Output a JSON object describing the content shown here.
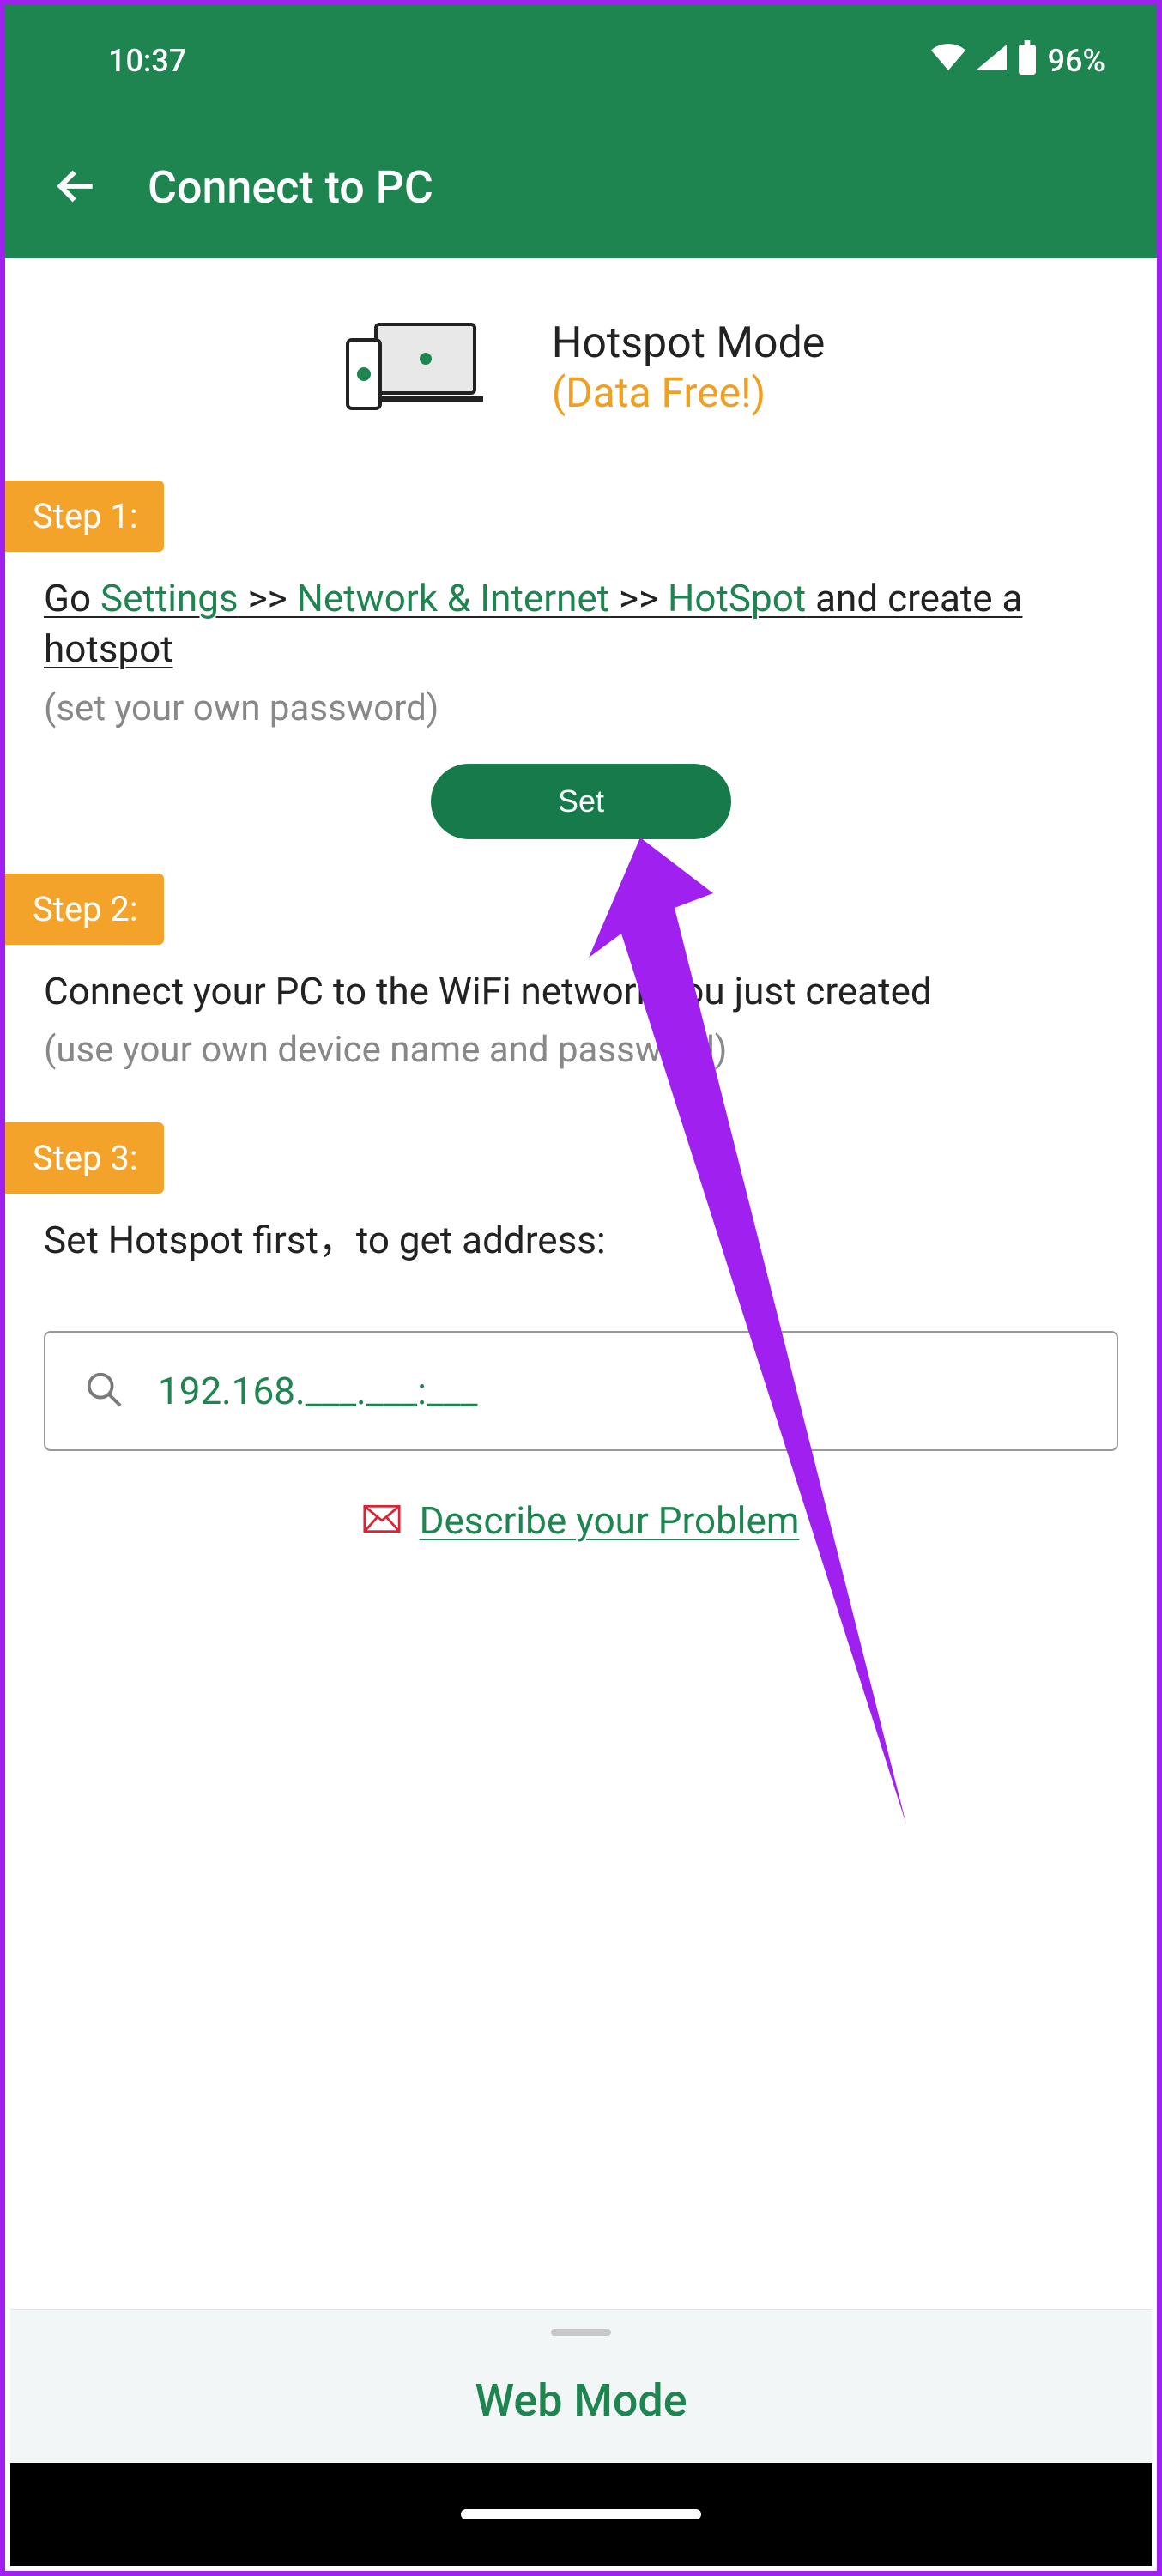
{
  "status": {
    "time": "10:37",
    "battery": "96%"
  },
  "appbar": {
    "title": "Connect to PC"
  },
  "hero": {
    "line1": "Hotspot Mode",
    "line2": "(Data Free!)"
  },
  "steps": {
    "step1_label": "Step 1:",
    "step1_segments": {
      "go": "Go ",
      "settings": "Settings",
      "sep1": " >> ",
      "network": "Network & Internet",
      "sep2": " >> ",
      "hotspot": "HotSpot",
      "tail": " and create a hotspot"
    },
    "step1_hint": "(set your own password)",
    "set_button": "Set",
    "step2_label": "Step 2:",
    "step2_text": "Connect your PC to the WiFi network you just created",
    "step2_hint": "(use your own device name and password)",
    "step3_label": "Step 3:",
    "step3_text": "Set Hotspot first，to get address:"
  },
  "ip": "192.168.___.___:___",
  "describe_link": "Describe your Problem",
  "bottom_panel": "Web Mode"
}
